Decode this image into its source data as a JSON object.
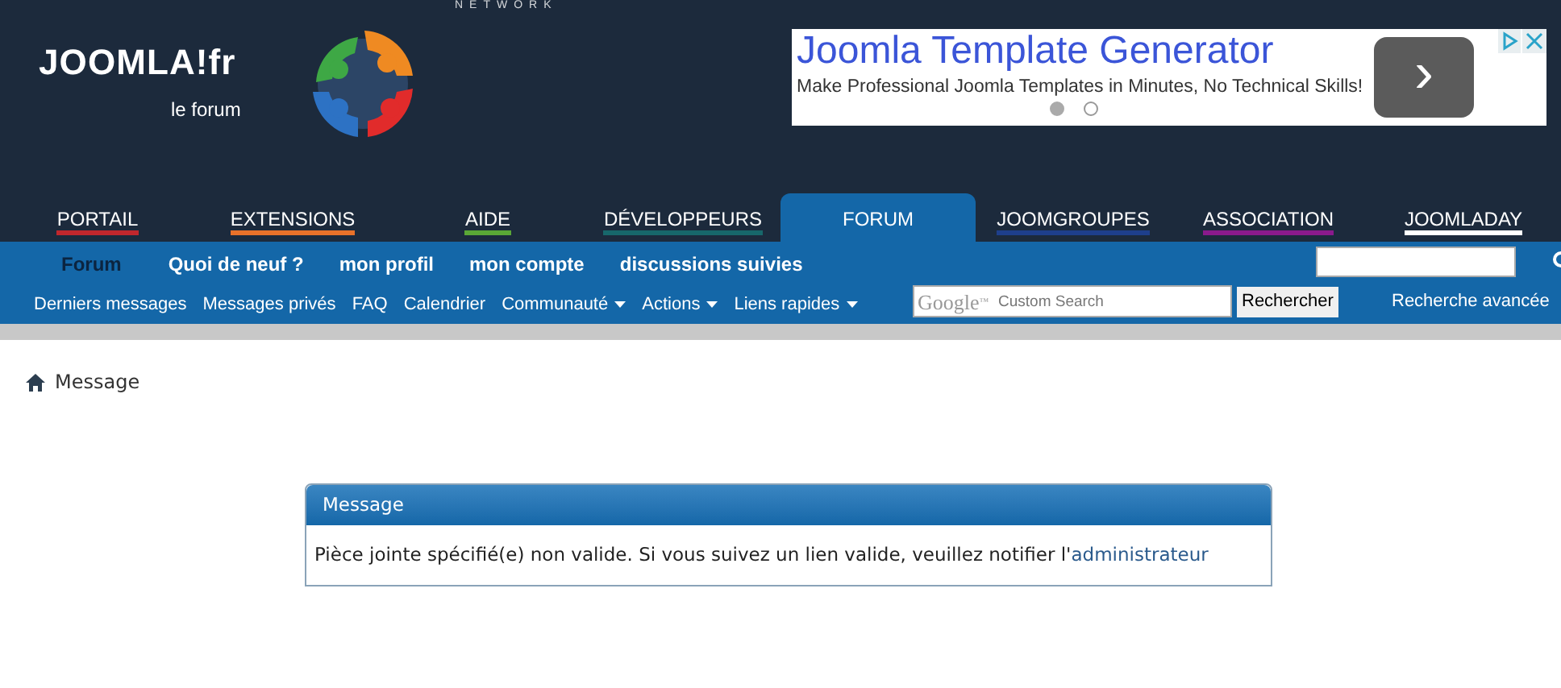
{
  "header": {
    "logo": "JOOMLA!fr",
    "tagline": "le forum",
    "network_text": "NETWORK"
  },
  "ad": {
    "title": "Joomla Template Generator",
    "text": "Make Professional Joomla Templates in Minutes, No Technical Skills!",
    "arrow": "›",
    "dots": [
      {
        "selected": true
      },
      {
        "selected": false
      }
    ]
  },
  "main_tabs": [
    {
      "label": "PORTAIL",
      "color": "#c0272d",
      "selected": false
    },
    {
      "label": "EXTENSIONS",
      "color": "#e8712a",
      "selected": false
    },
    {
      "label": "AIDE",
      "color": "#5aa736",
      "selected": false
    },
    {
      "label": "DÉVELOPPEURS",
      "color": "#17676b",
      "selected": false
    },
    {
      "label": "FORUM",
      "color": "#1467a8",
      "selected": true
    },
    {
      "label": "JOOMGROUPES",
      "color": "#1e3f8c",
      "selected": false
    },
    {
      "label": "ASSOCIATION",
      "color": "#8a1a8c",
      "selected": false
    },
    {
      "label": "JOOMLADAY",
      "color": "#ffffff",
      "selected": false
    }
  ],
  "sub_nav": [
    {
      "label": "Forum",
      "selected": true
    },
    {
      "label": "Quoi de neuf ?",
      "selected": false
    },
    {
      "label": "mon profil",
      "selected": false
    },
    {
      "label": "mon compte",
      "selected": false
    },
    {
      "label": "discussions suivies",
      "selected": false
    }
  ],
  "quick_links": [
    {
      "label": "Derniers messages",
      "kind": "link"
    },
    {
      "label": "Messages privés",
      "kind": "link"
    },
    {
      "label": "FAQ",
      "kind": "link"
    },
    {
      "label": "Calendrier",
      "kind": "link"
    },
    {
      "label": "Communauté",
      "kind": "menu"
    },
    {
      "label": "Actions",
      "kind": "menu"
    },
    {
      "label": "Liens rapides",
      "kind": "menu"
    }
  ],
  "google_search": {
    "logo": "Google",
    "tm": "™",
    "placeholder": "Custom Search",
    "button": "Rechercher"
  },
  "advanced_search": "Recherche avancée",
  "breadcrumb": "Message",
  "message": {
    "title": "Message",
    "text": "Pièce jointe spécifié(e) non valide. Si vous suivez un lien valide, veuillez notifier l'",
    "link": "administrateur"
  }
}
